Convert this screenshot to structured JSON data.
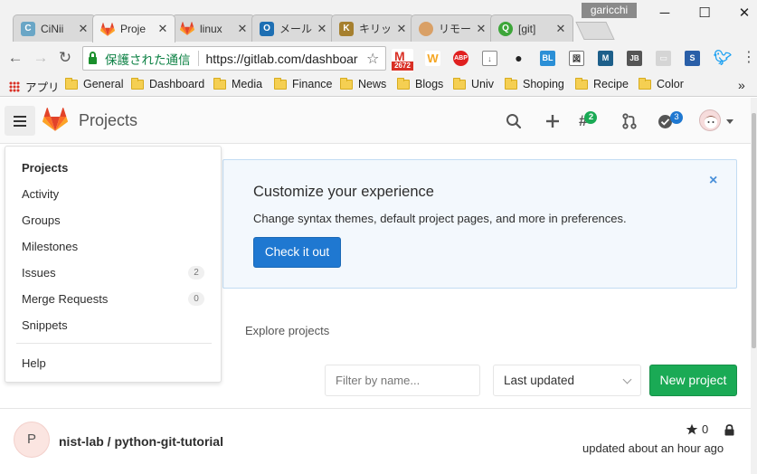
{
  "browser": {
    "profile_name": "garicchi",
    "tabs": [
      {
        "title": "CiNii",
        "favicon_color": "#66a3c2",
        "favicon_glyph": "C"
      },
      {
        "title": "Proje",
        "favicon_color": "#e24329",
        "favicon_glyph": ""
      },
      {
        "title": "linux",
        "favicon_color": "#e24329",
        "favicon_glyph": ""
      },
      {
        "title": "メール",
        "favicon_color": "#1e6fb3",
        "favicon_glyph": "O"
      },
      {
        "title": "キリッ",
        "favicon_color": "#a6802f",
        "favicon_glyph": "K"
      },
      {
        "title": "リモー",
        "favicon_color": "#d9a066",
        "favicon_glyph": ""
      },
      {
        "title": "[git]",
        "favicon_color": "#3da639",
        "favicon_glyph": "Q"
      }
    ],
    "secure_label": "保護された通信",
    "url": "https://gitlab.com/dashboar",
    "gmail_count": "2672",
    "bookmarks": [
      {
        "label": "アプリ",
        "icon": "apps-grid-icon"
      },
      {
        "label": "General",
        "icon": "folder-icon"
      },
      {
        "label": "Dashboard",
        "icon": "folder-icon"
      },
      {
        "label": "Media",
        "icon": "folder-icon"
      },
      {
        "label": "Finance",
        "icon": "folder-icon"
      },
      {
        "label": "News",
        "icon": "folder-icon"
      },
      {
        "label": "Blogs",
        "icon": "folder-icon"
      },
      {
        "label": "Univ",
        "icon": "folder-icon"
      },
      {
        "label": "Shoping",
        "icon": "folder-icon"
      },
      {
        "label": "Recipe",
        "icon": "folder-icon"
      },
      {
        "label": "Color",
        "icon": "folder-icon"
      }
    ],
    "overflow": "»"
  },
  "header": {
    "title": "Projects",
    "todos_count": "2",
    "issues_count": "3"
  },
  "sidebar": {
    "items": [
      {
        "label": "Projects",
        "badge": ""
      },
      {
        "label": "Activity",
        "badge": ""
      },
      {
        "label": "Groups",
        "badge": ""
      },
      {
        "label": "Milestones",
        "badge": ""
      },
      {
        "label": "Issues",
        "badge": "2"
      },
      {
        "label": "Merge Requests",
        "badge": "0"
      },
      {
        "label": "Snippets",
        "badge": ""
      }
    ],
    "help_label": "Help"
  },
  "banner": {
    "title": "Customize your experience",
    "text": "Change syntax themes, default project pages, and more in preferences.",
    "button_label": "Check it out",
    "close_glyph": "×"
  },
  "main": {
    "explore_label": "Explore projects",
    "filter_placeholder": "Filter by name...",
    "sort_value": "Last updated",
    "new_project_label": "New project"
  },
  "project": {
    "initial": "P",
    "name": "nist-lab / python-git-tutorial",
    "stars": "0",
    "updated": "updated about an hour ago"
  },
  "colors": {
    "accent_blue": "#1f78d1",
    "new_project_green": "#1aaa55",
    "gitlab_orange": "#e24329"
  }
}
